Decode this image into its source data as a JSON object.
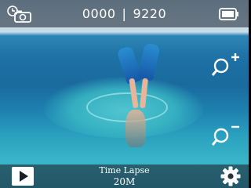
{
  "topbar": {
    "mode_icon": "timelapse-camera-icon",
    "counter_left": "0000",
    "separator": "|",
    "counter_right": "9220",
    "battery_icon": "battery-full-icon"
  },
  "zoom": {
    "in_icon": "zoom-in-icon",
    "out_icon": "zoom-out-icon"
  },
  "bottombar": {
    "play_icon": "play-icon",
    "mode_name": "Time Lapse",
    "resolution": "20M",
    "settings_icon": "gear-icon"
  },
  "colors": {
    "text": "#ffffff",
    "bar_bg": "#2a323c"
  }
}
